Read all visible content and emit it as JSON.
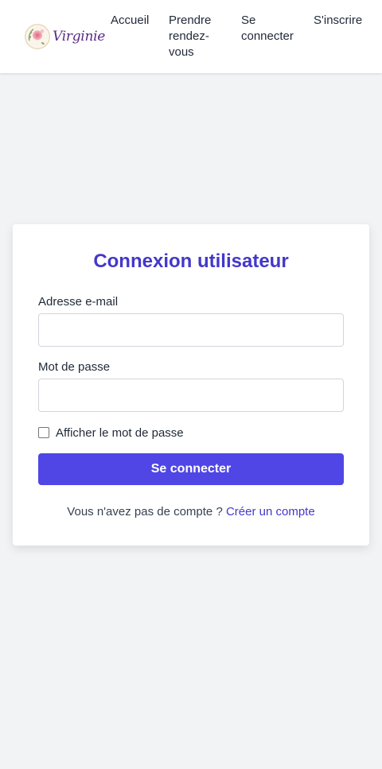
{
  "brand": {
    "name": "Virginie",
    "emblem_icon": "flower-wreath-icon"
  },
  "nav": {
    "items": [
      {
        "label": "Accueil"
      },
      {
        "label": "Prendre rendez-vous"
      },
      {
        "label": "Se connecter"
      },
      {
        "label": "S'inscrire"
      }
    ]
  },
  "login": {
    "title": "Connexion utilisateur",
    "email_label": "Adresse e-mail",
    "email_value": "",
    "password_label": "Mot de passe",
    "password_value": "",
    "show_password_label": "Afficher le mot de passe",
    "show_password_checked": false,
    "submit_label": "Se connecter",
    "no_account_text": "Vous n'avez pas de compte ?",
    "create_account_link": "Créer un compte"
  },
  "colors": {
    "accent": "#4f46e5",
    "title": "#4338ca",
    "background": "#f2f3f5",
    "brand_text": "#5b2a86"
  }
}
